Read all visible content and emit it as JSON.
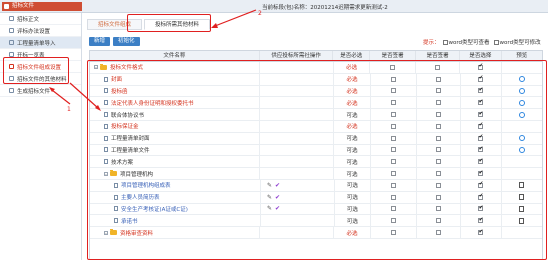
{
  "app": {
    "title": "招标文件"
  },
  "header": {
    "project_info": "当前标段(包)名称：20201214迟期需求更新测试-2"
  },
  "sidebar": {
    "items": [
      {
        "label": "招标正文"
      },
      {
        "label": "评标办法设置"
      },
      {
        "label": "工程量清单导入"
      },
      {
        "label": "开标一览表"
      },
      {
        "label": "招标文件组成设置"
      },
      {
        "label": "招标文件的其他材料"
      },
      {
        "label": "生成招标文件"
      }
    ]
  },
  "tabs": [
    {
      "label": "招标文件组成"
    },
    {
      "label": "投标所需其他材料"
    }
  ],
  "toolbar": {
    "new_label": "新增",
    "init_label": "初始化"
  },
  "tip": {
    "label": "提示：",
    "opt1": "word类型可查看",
    "opt2": "word类型可修改"
  },
  "table": {
    "columns": [
      "文件名称",
      "供应投标所需社操作",
      "是否必选",
      "是否签署",
      "是否选择",
      "预览"
    ],
    "rows": [
      {
        "name": "投标文件格式",
        "indent": 0,
        "type": "folder",
        "color": "red",
        "must": "必选",
        "sign": false,
        "select": true,
        "preview": ""
      },
      {
        "name": "封面",
        "indent": 1,
        "type": "file",
        "color": "red",
        "must": "必选",
        "sign": false,
        "select": true,
        "preview": "e"
      },
      {
        "name": "投标函",
        "indent": 1,
        "type": "file",
        "color": "red",
        "must": "必选",
        "sign": false,
        "select": true,
        "preview": "e"
      },
      {
        "name": "法定代表人身份证明和授权委托书",
        "indent": 1,
        "type": "file",
        "color": "red",
        "must": "必选",
        "sign": false,
        "select": true,
        "preview": "e"
      },
      {
        "name": "联合体协议书",
        "indent": 1,
        "type": "file",
        "color": "normal",
        "must": "可选",
        "sign": false,
        "select": true,
        "preview": "e"
      },
      {
        "name": "投标保证金",
        "indent": 1,
        "type": "file",
        "color": "red",
        "must": "必选",
        "sign": false,
        "select": true,
        "preview": ""
      },
      {
        "name": "工程量清单封面",
        "indent": 1,
        "type": "file",
        "color": "normal",
        "must": "可选",
        "sign": false,
        "select": true,
        "preview": "e"
      },
      {
        "name": "工程量清单文件",
        "indent": 1,
        "type": "file",
        "color": "normal",
        "must": "可选",
        "sign": false,
        "select": true,
        "preview": "e"
      },
      {
        "name": "技术方案",
        "indent": 1,
        "type": "file",
        "color": "normal",
        "must": "可选",
        "sign": false,
        "select": true,
        "preview": ""
      },
      {
        "name": "项目管理机构",
        "indent": 1,
        "type": "folder",
        "color": "normal",
        "must": "可选",
        "sign": false,
        "select": true,
        "preview": ""
      },
      {
        "name": "项目管理机构组成表",
        "indent": 2,
        "type": "file",
        "color": "blue",
        "must": "可选",
        "sign": false,
        "select": true,
        "preview": "doc",
        "op": true
      },
      {
        "name": "主要人员简历表",
        "indent": 2,
        "type": "file",
        "color": "blue",
        "must": "可选",
        "sign": false,
        "select": true,
        "preview": "doc",
        "op": true
      },
      {
        "name": "安全生产考核证(A证或C证)",
        "indent": 2,
        "type": "file",
        "color": "blue",
        "must": "可选",
        "sign": false,
        "select": true,
        "preview": "doc",
        "op": true
      },
      {
        "name": "承诺书",
        "indent": 2,
        "type": "file",
        "color": "blue",
        "must": "可选",
        "sign": false,
        "select": true,
        "preview": "doc"
      },
      {
        "name": "资格审查资料",
        "indent": 1,
        "type": "folder",
        "color": "red",
        "must": "必选",
        "sign": false,
        "select": true,
        "preview": ""
      }
    ]
  },
  "annotations": {
    "a1": "1",
    "a2": "2"
  },
  "colors": {
    "accent": "#3c7fc5",
    "highlight": "#e02020",
    "required": "#d4321e"
  }
}
